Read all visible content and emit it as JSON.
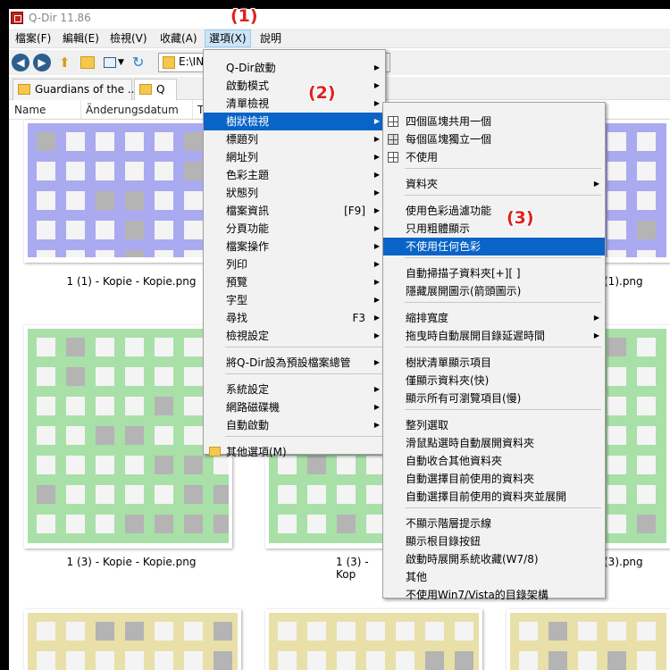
{
  "window": {
    "title": "Q-Dir 11.86"
  },
  "menubar": {
    "items": [
      "檔案(F)",
      "編輯(E)",
      "檢視(V)",
      "收藏(A)",
      "選項(X)",
      "說明"
    ]
  },
  "address": {
    "text": "E:\\INI"
  },
  "tabs": [
    {
      "label": "Guardians of the ..."
    },
    {
      "label": "Q"
    }
  ],
  "columns": [
    "Name",
    "Änderungsdatum",
    "T"
  ],
  "files": [
    {
      "caption": "1 (1) - Kopie - Kopie.png"
    },
    {
      "caption": "(1).png"
    },
    {
      "caption": "1 (3) - Kopie - Kopie.png"
    },
    {
      "caption": "1 (3) - Kop"
    },
    {
      "caption": "(3).png"
    }
  ],
  "options_menu": {
    "items": [
      {
        "label": "Q-Dir啟動",
        "submenu": true
      },
      {
        "label": "啟動模式",
        "submenu": true
      },
      {
        "label": "清單檢視",
        "submenu": true
      },
      {
        "label": "樹狀檢視",
        "submenu": true,
        "highlighted": true
      },
      {
        "label": "標題列",
        "submenu": true
      },
      {
        "label": "網址列",
        "submenu": true
      },
      {
        "label": "色彩主題",
        "submenu": true
      },
      {
        "label": "狀態列",
        "submenu": true
      },
      {
        "label": "檔案資訊",
        "shortcut": "[F9]",
        "submenu": true
      },
      {
        "label": "分頁功能",
        "submenu": true
      },
      {
        "label": "檔案操作",
        "submenu": true
      },
      {
        "label": "列印",
        "submenu": true
      },
      {
        "label": "預覽",
        "submenu": true
      },
      {
        "label": "字型",
        "submenu": true
      },
      {
        "label": "尋找",
        "shortcut": "F3",
        "submenu": true
      },
      {
        "label": "檢視設定",
        "submenu": true
      },
      {
        "label": "將Q-Dir設為預設檔案總管",
        "submenu": true
      },
      {
        "label": "系統設定",
        "submenu": true
      },
      {
        "label": "網路磁碟機",
        "submenu": true
      },
      {
        "label": "自動啟動",
        "submenu": true
      },
      {
        "label": "其他選項(M)",
        "submenu": false
      }
    ]
  },
  "tree_submenu": {
    "items": [
      {
        "label": "四個區塊共用一個"
      },
      {
        "label": "每個區塊獨立一個"
      },
      {
        "label": "不使用"
      },
      {
        "label": "資料夾",
        "submenu": true
      },
      {
        "label": "使用色彩過濾功能"
      },
      {
        "label": "只用粗體顯示"
      },
      {
        "label": "不使用任何色彩",
        "highlighted": true
      },
      {
        "label": "自動掃描子資料夾[+][ ]"
      },
      {
        "label": "隱藏展開圖示(箭頭圖示)"
      },
      {
        "label": "縮排寬度",
        "submenu": true
      },
      {
        "label": "拖曳時自動展開目錄延遲時間",
        "submenu": true
      },
      {
        "label": "樹狀清單顯示項目"
      },
      {
        "label": "僅顯示資料夾(快)"
      },
      {
        "label": "顯示所有可瀏覽項目(慢)"
      },
      {
        "label": "整列選取"
      },
      {
        "label": "滑鼠點選時自動展開資料夾"
      },
      {
        "label": "自動收合其他資料夾"
      },
      {
        "label": "自動選擇目前使用的資料夾"
      },
      {
        "label": "自動選擇目前使用的資料夾並展開"
      },
      {
        "label": "不顯示階層提示線"
      },
      {
        "label": "顯示根目錄按鈕"
      },
      {
        "label": "啟動時展開系統收藏(W7/8)"
      },
      {
        "label": "其他"
      },
      {
        "label": "不使用Win7/Vista的目錄架構"
      }
    ]
  },
  "annotations": [
    "(1)",
    "(2)",
    "(3)"
  ],
  "colors": {
    "highlight": "#0a64c8",
    "annotation": "#e02020",
    "purple_thumb": "#aaaaf0",
    "green_thumb": "#a8e0a8",
    "yellow_thumb": "#e8e0a8"
  }
}
